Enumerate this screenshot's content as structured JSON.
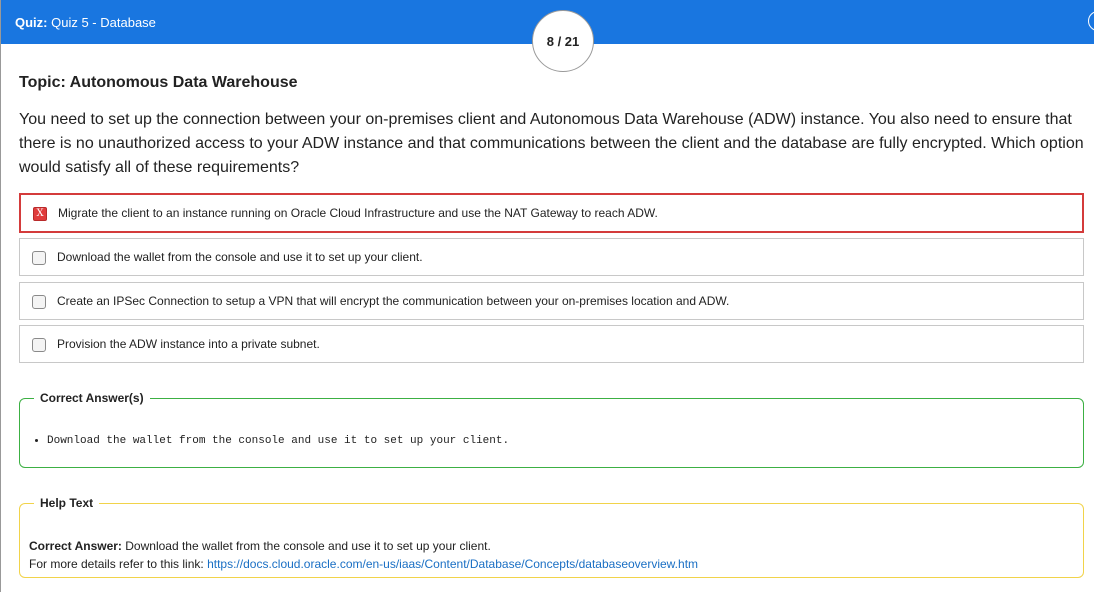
{
  "header": {
    "quiz_label": "Quiz:",
    "quiz_name": "Quiz 5 - Database",
    "counter": "8 / 21"
  },
  "topic": "Topic: Autonomous Data Warehouse",
  "question": "You need to set up the connection between your on-premises client and Autonomous Data Warehouse (ADW) instance.  You also need to ensure that there is no unauthorized access to your ADW instance and that communications between the client and the database are fully encrypted.  Which option would satisfy all of these requirements?",
  "options": [
    {
      "label": "Migrate the client to an instance running on Oracle Cloud Infrastructure and use the NAT Gateway to reach ADW.",
      "state": "wrong",
      "mark": "X"
    },
    {
      "label": "Download the wallet from the console and use it to set up your client.",
      "state": "unchecked"
    },
    {
      "label": "Create an IPSec Connection to setup a VPN that will encrypt the communication between your on-premises location and ADW.",
      "state": "unchecked"
    },
    {
      "label": "Provision the ADW instance into a private subnet.",
      "state": "unchecked"
    }
  ],
  "correct_answers": {
    "legend": "Correct Answer(s)",
    "items": [
      "Download the wallet from the console and use it to set up your client."
    ]
  },
  "help": {
    "legend": "Help Text",
    "answer_label": "Correct Answer:",
    "answer_text": "Download the wallet from the console and use it to set up your client.",
    "details_prefix": "For more details refer to this link:",
    "link_text": "https://docs.cloud.oracle.com/en-us/iaas/Content/Database/Concepts/databaseoverview.htm"
  },
  "colors": {
    "header_bg": "#1976e0",
    "wrong_border": "#d43b3b",
    "correct_border": "#3cb043",
    "help_border": "#f1d34a",
    "link": "#1a6fc4"
  }
}
